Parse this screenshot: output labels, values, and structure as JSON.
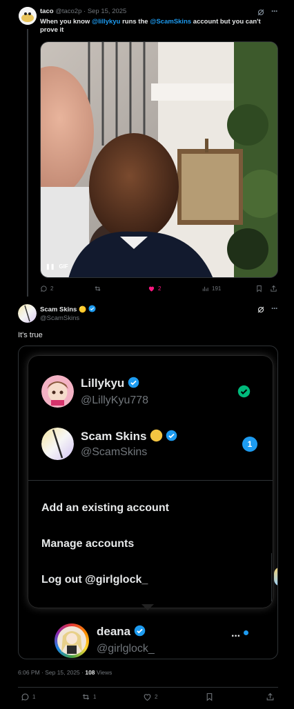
{
  "reply_tweet": {
    "author_name": "taco",
    "author_handle": "@taco2p",
    "separator": "·",
    "date": "Sep 15, 2025",
    "text_part1": "When you know ",
    "mention1": "@lillykyu",
    "text_part2": " runs the ",
    "mention2": "@ScamSkins",
    "text_part3": " account but you can't prove it",
    "media_badge": "GIF",
    "stats": {
      "replies": "2",
      "reposts": "",
      "likes": "2",
      "views": "191"
    },
    "colors": {
      "like_active": "#f91880"
    }
  },
  "main_tweet": {
    "author_name": "Scam Skins",
    "author_emoji": "🟡",
    "author_handle": "@ScamSkins",
    "text": "It's true",
    "timestamp": "6:06 PM · Sep 15, 2025 · ",
    "views_count": "108",
    "views_label": " Views",
    "stats": {
      "replies": "1",
      "reposts": "1",
      "likes": "2"
    }
  },
  "embedded_screenshot": {
    "accounts": [
      {
        "name": "Lillykyu",
        "handle": "@LillyKyu778",
        "status_icon": "check-circle-icon"
      },
      {
        "name": "Scam Skins",
        "handle": "@ScamSkins",
        "badge": "1"
      }
    ],
    "menu": {
      "add_account": "Add an existing account",
      "manage_accounts": "Manage accounts",
      "logout": "Log out @girlglock_"
    },
    "current_account": {
      "name": "deana",
      "handle": "@girlglock_"
    }
  },
  "colors": {
    "background": "#000000",
    "text_primary": "#e7e9ea",
    "text_muted": "#71767b",
    "accent_blue": "#1d9bf0",
    "verified_blue": "#1d9bf0",
    "check_green": "#00ba7c",
    "border": "#2f3336"
  }
}
